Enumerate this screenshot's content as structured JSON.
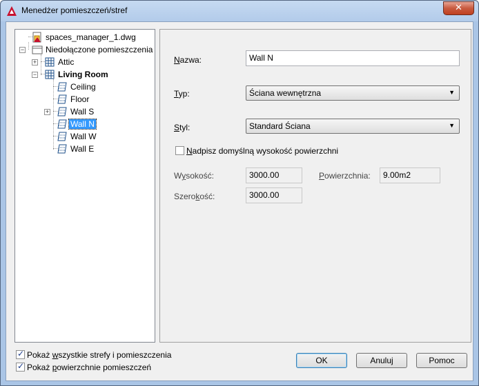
{
  "window": {
    "title": "Menedżer pomieszczeń/stref",
    "close_label": "✕"
  },
  "tree": {
    "root_file": "spaces_manager_1.dwg",
    "unattached": "Niedołączone pomieszczenia",
    "attic": "Attic",
    "living_room": "Living Room",
    "children": [
      "Ceiling",
      "Floor",
      "Wall S",
      "Wall N",
      "Wall W",
      "Wall E"
    ],
    "selected": "Wall N"
  },
  "form": {
    "name_label_u": "N",
    "name_label_rest": "azwa:",
    "name_value": "Wall N",
    "type_label_u": "T",
    "type_label_rest": "yp:",
    "type_value": "Ściana wewnętrzna",
    "style_label_u": "S",
    "style_label_rest": "tyl:",
    "style_value": "Standard Ściana",
    "override_label_u": "N",
    "override_label_rest": "adpisz domyślną wysokość powierzchni",
    "override_checked": false,
    "height_label_pre": "W",
    "height_label_u": "y",
    "height_label_rest": "sokość:",
    "height_value": "3000.00",
    "area_label_u": "P",
    "area_label_rest": "owierzchnia:",
    "area_value": "9.00m2",
    "width_label_pre": "Szero",
    "width_label_u": "k",
    "width_label_rest": "ość:",
    "width_value": "3000.00"
  },
  "options": {
    "show_all_pre": "Pokaż ",
    "show_all_u": "w",
    "show_all_rest": "szystkie strefy i pomieszczenia",
    "show_all_checked": true,
    "show_surfaces_pre": "Pokaż ",
    "show_surfaces_u": "p",
    "show_surfaces_rest": "owierzchnie pomieszczeń",
    "show_surfaces_checked": true
  },
  "buttons": {
    "ok": "OK",
    "cancel": "Anuluj",
    "help": "Pomoc"
  }
}
